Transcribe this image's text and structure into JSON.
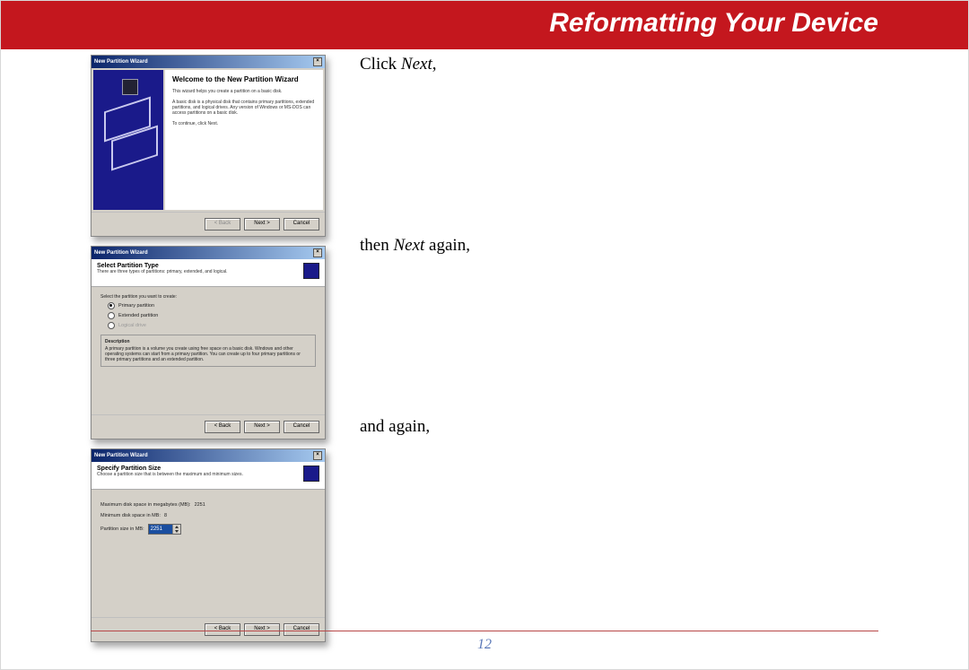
{
  "header": {
    "title": "Reformatting Your Device"
  },
  "page_number": "12",
  "instructions": {
    "step1_pre": "Click ",
    "step1_em": "Next",
    "step1_post": ",",
    "step2_pre": "then ",
    "step2_em": "Next",
    "step2_post": " again,",
    "step3": "and again,"
  },
  "wizard1": {
    "window_title": "New Partition Wizard",
    "heading": "Welcome to the New Partition Wizard",
    "line1": "This wizard helps you create a partition on a basic disk.",
    "line2": "A basic disk is a physical disk that contains primary partitions, extended partitions, and logical drives. Any version of Windows or MS-DOS can access partitions on a basic disk.",
    "line3": "To continue, click Next.",
    "buttons": {
      "back": "< Back",
      "next": "Next >",
      "cancel": "Cancel"
    }
  },
  "wizard2": {
    "window_title": "New Partition Wizard",
    "header_title": "Select Partition Type",
    "header_sub": "There are three types of partitions: primary, extended, and logical.",
    "prompt": "Select the partition you want to create:",
    "opt_primary": "Primary partition",
    "opt_extended": "Extended partition",
    "opt_logical": "Logical drive",
    "desc_label": "Description",
    "desc_text": "A primary partition is a volume you create using free space on a basic disk. Windows and other operating systems can start from a primary partition. You can create up to four primary partitions or three primary partitions and an extended partition.",
    "buttons": {
      "back": "< Back",
      "next": "Next >",
      "cancel": "Cancel"
    }
  },
  "wizard3": {
    "window_title": "New Partition Wizard",
    "header_title": "Specify Partition Size",
    "header_sub": "Choose a partition size that is between the maximum and minimum sizes.",
    "max_label": "Maximum disk space in megabytes (MB):",
    "max_val": "2251",
    "min_label": "Minimum disk space in MB:",
    "min_val": "8",
    "size_label": "Partition size in MB:",
    "size_val": "2251",
    "buttons": {
      "back": "< Back",
      "next": "Next >",
      "cancel": "Cancel"
    }
  }
}
